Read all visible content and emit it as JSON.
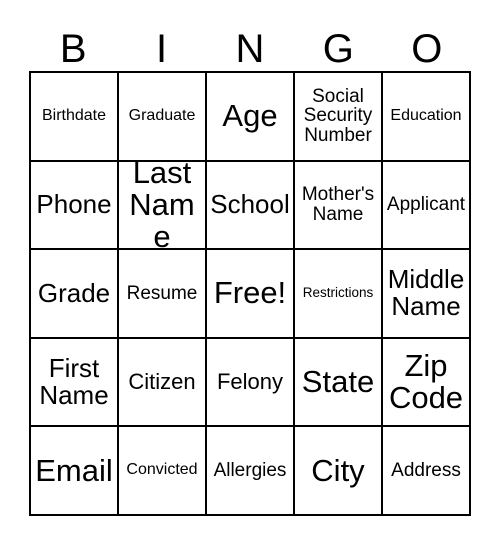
{
  "card": {
    "title": "Bingo Card",
    "columns": 5,
    "rows": 5,
    "header_letters": [
      "B",
      "I",
      "N",
      "G",
      "O"
    ],
    "colors": {
      "border": "#000000",
      "text": "#000000",
      "background": "#ffffff"
    },
    "free_space_label": "Free!",
    "free_space_position": {
      "row": 3,
      "column": 3
    },
    "grid": [
      [
        {
          "label": "Birthdate",
          "size": "s"
        },
        {
          "label": "Graduate",
          "size": "s"
        },
        {
          "label": "Age",
          "size": "xxl"
        },
        {
          "label": "Social Security Number",
          "size": "m"
        },
        {
          "label": "Education",
          "size": "s"
        }
      ],
      [
        {
          "label": "Phone",
          "size": "xl"
        },
        {
          "label": "Last Name",
          "size": "xxl"
        },
        {
          "label": "School",
          "size": "xl"
        },
        {
          "label": "Mother's Name",
          "size": "m"
        },
        {
          "label": "Applicant",
          "size": "m"
        }
      ],
      [
        {
          "label": "Grade",
          "size": "xl"
        },
        {
          "label": "Resume",
          "size": "m"
        },
        {
          "label": "Free!",
          "size": "xxl"
        },
        {
          "label": "Restrictions",
          "size": "xs"
        },
        {
          "label": "Middle Name",
          "size": "xl"
        }
      ],
      [
        {
          "label": "First Name",
          "size": "xl"
        },
        {
          "label": "Citizen",
          "size": "l"
        },
        {
          "label": "Felony",
          "size": "l"
        },
        {
          "label": "State",
          "size": "xxl"
        },
        {
          "label": "Zip Code",
          "size": "xxl"
        }
      ],
      [
        {
          "label": "Email",
          "size": "xxl"
        },
        {
          "label": "Convicted",
          "size": "s"
        },
        {
          "label": "Allergies",
          "size": "m"
        },
        {
          "label": "City",
          "size": "xxl"
        },
        {
          "label": "Address",
          "size": "m"
        }
      ]
    ]
  }
}
